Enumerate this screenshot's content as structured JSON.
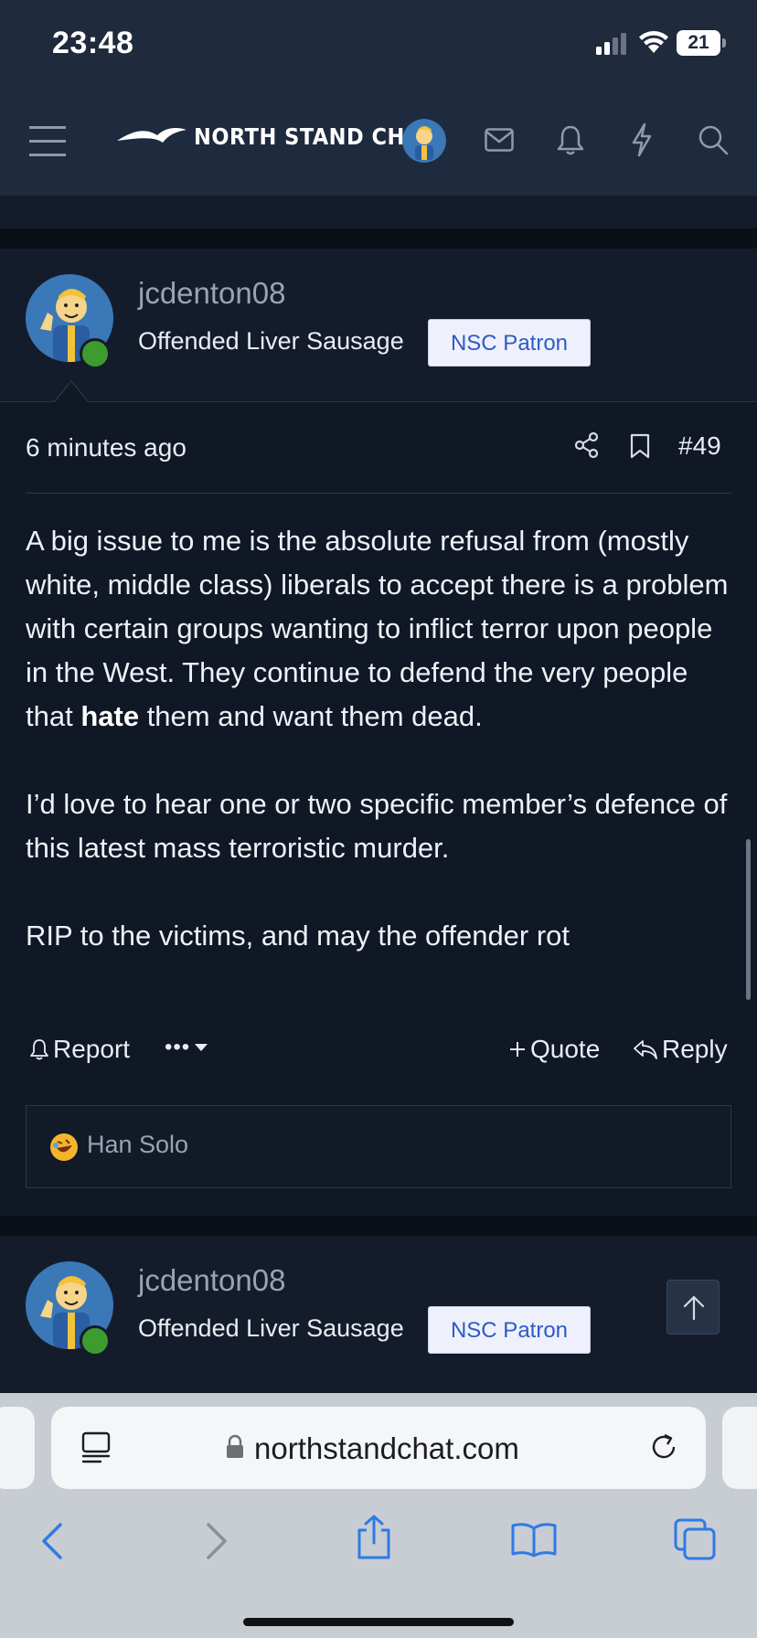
{
  "status_bar": {
    "time": "23:48",
    "battery": "21"
  },
  "header": {
    "logo_text": "NORTH STAND CHAT"
  },
  "post": {
    "username": "jcdenton08",
    "user_title": "Offended Liver Sausage",
    "badge": "NSC Patron",
    "time": "6 minutes ago",
    "number": "#49",
    "paragraph1_before": "A big issue to me is the absolute refusal from (mostly white, middle class) liberals to accept there is a problem with certain groups wanting to inflict terror upon people in the West. They continue to defend the very people that ",
    "paragraph1_bold": "hate",
    "paragraph1_after": " them and want them dead.",
    "paragraph2": "I’d love to hear one or two specific member’s defence of this latest mass terroristic murder.",
    "paragraph3": "RIP to the victims, and may the offender rot",
    "actions": {
      "report": "Report",
      "more": "•••",
      "quote": "Quote",
      "reply": "Reply"
    },
    "reactions": {
      "name": "Han Solo",
      "emoji": "rolling-laughing-emoji"
    }
  },
  "next_post": {
    "username": "jcdenton08",
    "user_title": "Offended Liver Sausage",
    "badge": "NSC Patron"
  },
  "browser": {
    "url": "northstandchat.com"
  },
  "colors": {
    "background": "#101725",
    "header": "#1e2a3d",
    "badge_text": "#2f59c8",
    "online": "#3d9b2f",
    "browser_accent": "#2f7ae5"
  }
}
